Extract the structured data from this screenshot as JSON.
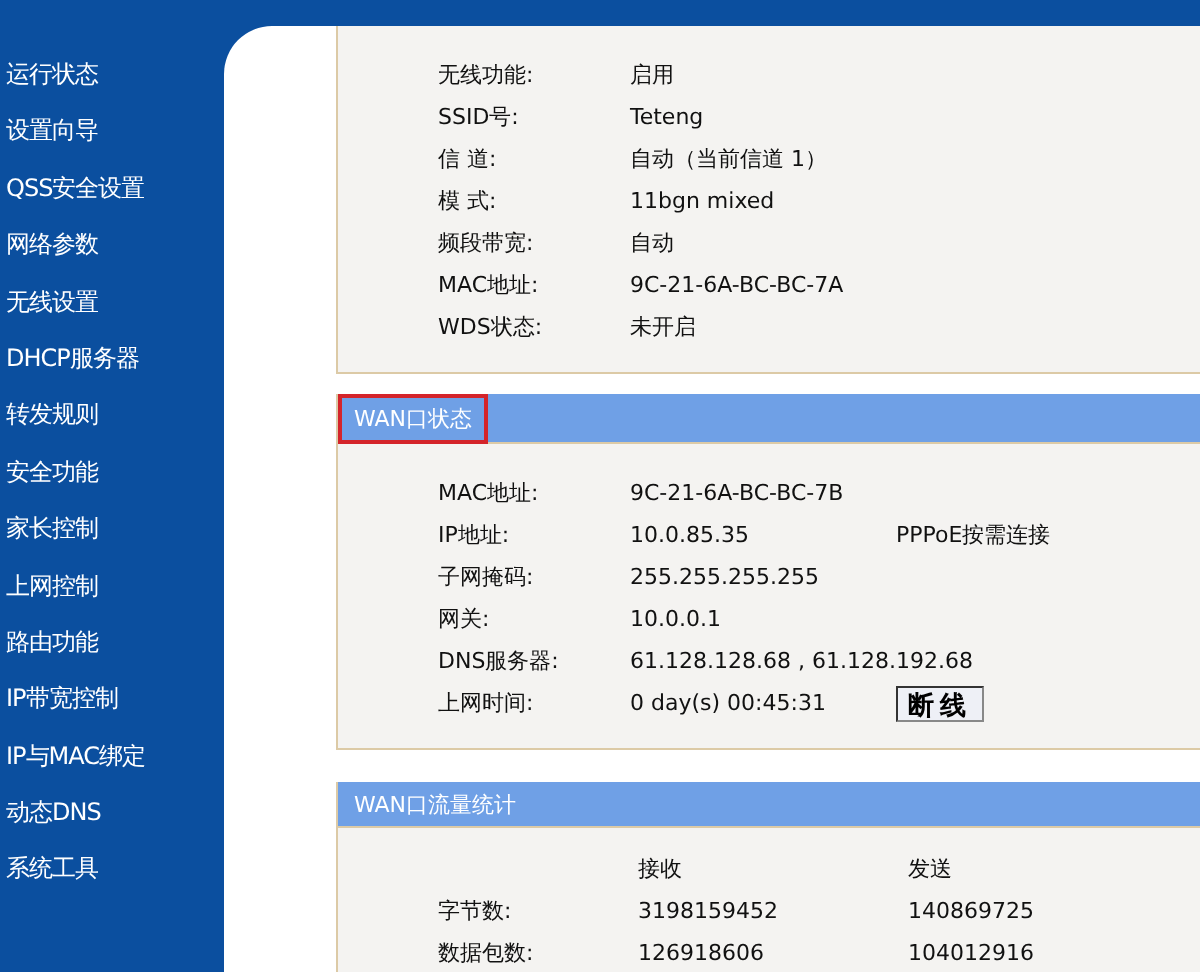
{
  "sidebar": {
    "items": [
      {
        "label": "运行状态"
      },
      {
        "label": "设置向导"
      },
      {
        "label": "QSS安全设置"
      },
      {
        "label": "网络参数"
      },
      {
        "label": "无线设置"
      },
      {
        "label": "DHCP服务器"
      },
      {
        "label": "转发规则"
      },
      {
        "label": "安全功能"
      },
      {
        "label": "家长控制"
      },
      {
        "label": "上网控制"
      },
      {
        "label": "路由功能"
      },
      {
        "label": "IP带宽控制"
      },
      {
        "label": "IP与MAC绑定"
      },
      {
        "label": "动态DNS"
      },
      {
        "label": "系统工具"
      }
    ]
  },
  "wireless": {
    "rows": [
      {
        "label": "无线功能:",
        "value": "启用"
      },
      {
        "label": "SSID号:",
        "value": "Teteng"
      },
      {
        "label": "信 道:",
        "value": "自动（当前信道 1）"
      },
      {
        "label": "模 式:",
        "value": "11bgn mixed"
      },
      {
        "label": "频段带宽:",
        "value": "自动"
      },
      {
        "label": "MAC地址:",
        "value": "9C-21-6A-BC-BC-7A"
      },
      {
        "label": "WDS状态:",
        "value": "未开启"
      }
    ]
  },
  "wan": {
    "title": "WAN口状态",
    "highlighted": true,
    "rows": [
      {
        "label": "MAC地址:",
        "value": "9C-21-6A-BC-BC-7B"
      },
      {
        "label": "IP地址:",
        "value": "10.0.85.35",
        "extra": "PPPoE按需连接"
      },
      {
        "label": "子网掩码:",
        "value": "255.255.255.255"
      },
      {
        "label": "网关:",
        "value": "10.0.0.1"
      },
      {
        "label": "DNS服务器:",
        "value": "61.128.128.68 , 61.128.192.68"
      },
      {
        "label": "上网时间:",
        "value": "0 day(s) 00:45:31",
        "button": "断线"
      }
    ]
  },
  "traffic": {
    "title": "WAN口流量统计",
    "columns": [
      "接收",
      "发送"
    ],
    "rows": [
      {
        "label": "字节数:",
        "received": "3198159452",
        "sent": "140869725"
      },
      {
        "label": "数据包数:",
        "received": "126918606",
        "sent": "104012916"
      }
    ]
  }
}
